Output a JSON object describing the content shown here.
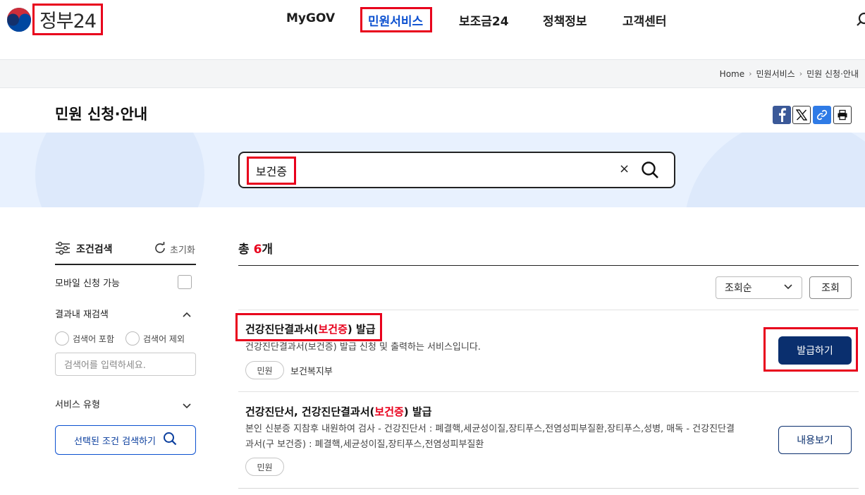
{
  "header": {
    "logo_text": "정부24",
    "nav": [
      "MyGOV",
      "민원서비스",
      "보조금24",
      "정책정보",
      "고객센터"
    ],
    "active_nav": "민원서비스"
  },
  "breadcrumb": [
    "Home",
    "민원서비스",
    "민원 신청·안내"
  ],
  "page_title": "민원 신청·안내",
  "share_icons": [
    "facebook-icon",
    "x-icon",
    "link-icon",
    "print-icon"
  ],
  "search": {
    "query": "보건증",
    "clear_label": "×"
  },
  "sidebar": {
    "title": "조건검색",
    "reset_label": "초기화",
    "mobile_label": "모바일 신청 가능",
    "research_label": "결과내 재검색",
    "include_label": "검색어 포함",
    "exclude_label": "검색어 제외",
    "input_placeholder": "검색어를 입력하세요.",
    "service_type_label": "서비스 유형",
    "search_button_label": "선택된 조건 검색하기"
  },
  "results": {
    "total_prefix": "총 ",
    "total_count": "6",
    "total_suffix": "개",
    "sort_value": "조회순",
    "sort_button_label": "조회",
    "items": [
      {
        "title_before": "건강진단결과서(",
        "title_highlight": "보건증",
        "title_after": ") 발급",
        "description": "건강진단결과서(보건증) 발급 신청 및 출력하는 서비스입니다.",
        "tag": "민원",
        "department": "보건복지부",
        "action_label": "발급하기"
      },
      {
        "title_before": "건강진단서, 건강진단결과서(",
        "title_highlight": "보건증",
        "title_after": ") 발급",
        "description_line1": "본인 신분증 지참후 내원하여 검사 - 건강진단서 : 폐결핵,세균성이질,장티푸스,전염성피부질환,장티푸스,성병, 매독 - 건강진단결",
        "description_line2": "과서(구 보건증) : 폐결핵,세균성이질,장티푸스,전염성피부질환",
        "tag": "민원",
        "action_label": "내용보기"
      }
    ]
  },
  "colors": {
    "accent": "#0b50d0",
    "highlight": "#e8001c",
    "navy": "#0a2f6e",
    "band": "#e8f1fe"
  }
}
